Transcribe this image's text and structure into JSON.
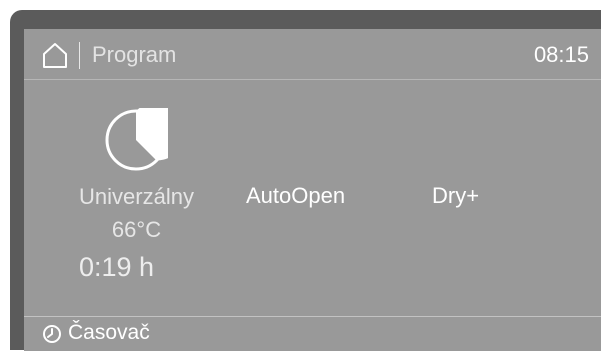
{
  "header": {
    "title": "Program",
    "time": "08:15",
    "home_icon": "home-icon"
  },
  "program": {
    "icon": "program-pie-icon",
    "name": "Univerzálny",
    "temperature": "66°C",
    "duration": "0:19 h"
  },
  "options": {
    "autoopen_label": "AutoOpen",
    "dry_label": "Dry+"
  },
  "footer": {
    "timer_label": "Časovač",
    "timer_icon": "clock-icon"
  },
  "colors": {
    "bezel": "#5b5b5b",
    "screen": "#999999",
    "text": "#ffffff",
    "muted_text": "#e6e6e6"
  }
}
